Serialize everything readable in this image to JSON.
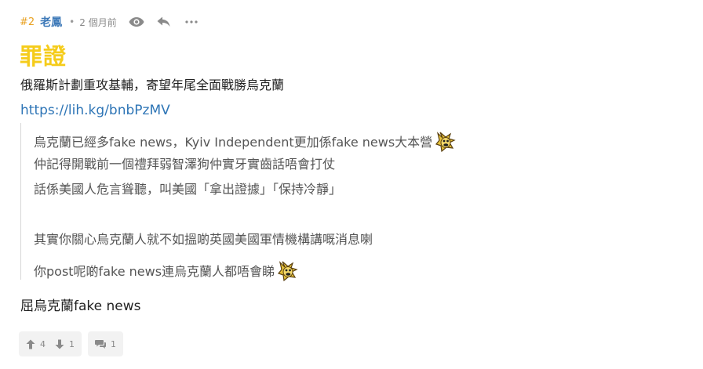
{
  "post": {
    "floor": "#2",
    "author": "老鳳",
    "separator": "•",
    "time": "2 個月前",
    "icons": {
      "view": "eye-icon",
      "reply": "reply-icon",
      "more": "more-icon"
    },
    "title": "罪證",
    "line1": "俄羅斯計劃重攻基輔，寄望年尾全面戰勝烏克蘭",
    "link": "https://lih.kg/bnbPzMV",
    "quote": {
      "line1": "烏克蘭已經多fake news，Kyiv Independent更加係fake news大本營",
      "line2": "仲記得開戰前一個禮拜弱智澤狗仲實牙實齒話唔會打仗",
      "line3": "話係美國人危言聳聽，叫美國「拿出證據」「保持冷靜」",
      "line4": "其實你關心烏克蘭人就不如搵啲英國美國軍情機構講嘅消息喇",
      "line5": "你post呢啲fake news連烏克蘭人都唔會睇"
    },
    "final_line": "屈烏克蘭fake news",
    "upvotes": "4",
    "downvotes": "1",
    "comments": "1",
    "colors": {
      "floor": "#e8a020",
      "author": "#3d79b8",
      "title": "#f5cc1b",
      "link": "#2e75b6"
    }
  }
}
